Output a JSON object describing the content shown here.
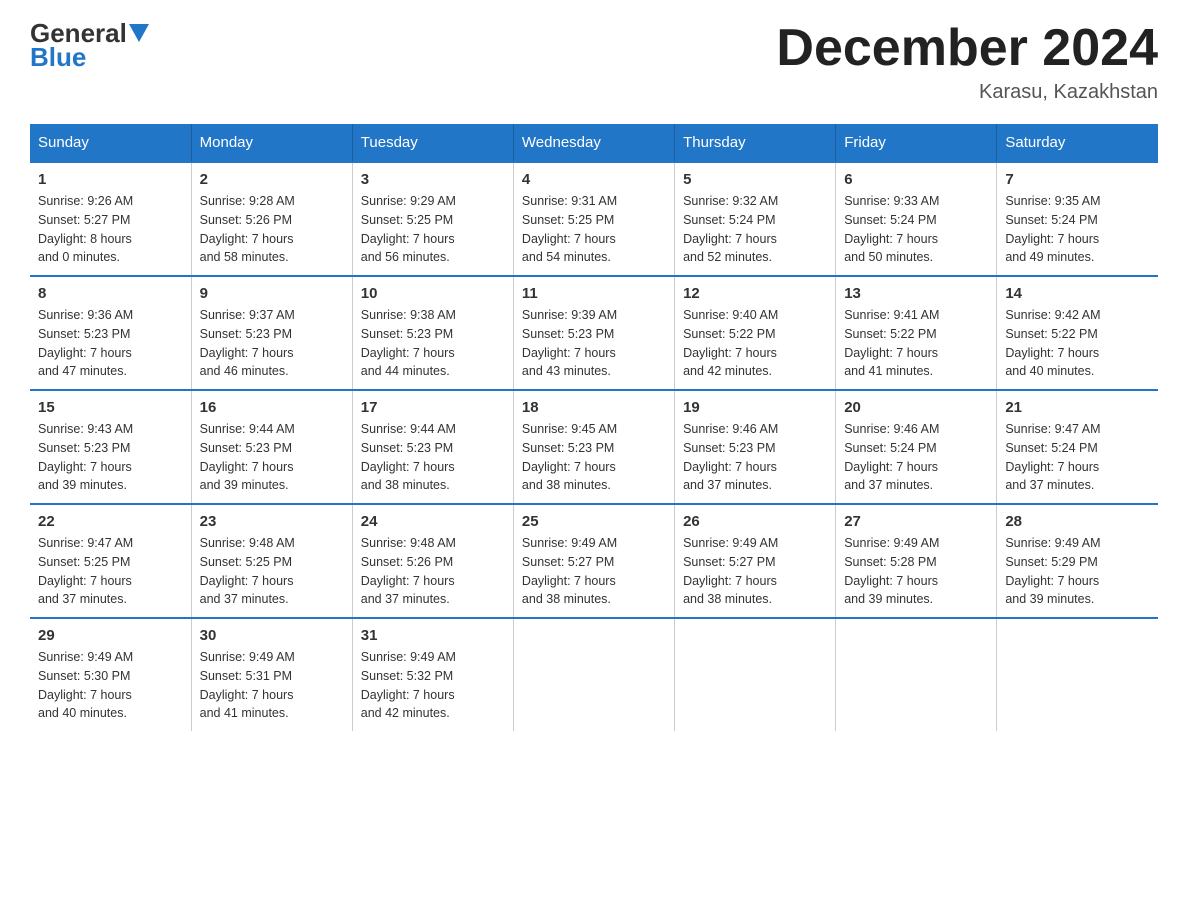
{
  "header": {
    "logo_general": "General",
    "logo_blue": "Blue",
    "month_title": "December 2024",
    "location": "Karasu, Kazakhstan"
  },
  "days_of_week": [
    "Sunday",
    "Monday",
    "Tuesday",
    "Wednesday",
    "Thursday",
    "Friday",
    "Saturday"
  ],
  "weeks": [
    [
      {
        "day": "1",
        "sunrise": "9:26 AM",
        "sunset": "5:27 PM",
        "daylight": "8 hours and 0 minutes."
      },
      {
        "day": "2",
        "sunrise": "9:28 AM",
        "sunset": "5:26 PM",
        "daylight": "7 hours and 58 minutes."
      },
      {
        "day": "3",
        "sunrise": "9:29 AM",
        "sunset": "5:25 PM",
        "daylight": "7 hours and 56 minutes."
      },
      {
        "day": "4",
        "sunrise": "9:31 AM",
        "sunset": "5:25 PM",
        "daylight": "7 hours and 54 minutes."
      },
      {
        "day": "5",
        "sunrise": "9:32 AM",
        "sunset": "5:24 PM",
        "daylight": "7 hours and 52 minutes."
      },
      {
        "day": "6",
        "sunrise": "9:33 AM",
        "sunset": "5:24 PM",
        "daylight": "7 hours and 50 minutes."
      },
      {
        "day": "7",
        "sunrise": "9:35 AM",
        "sunset": "5:24 PM",
        "daylight": "7 hours and 49 minutes."
      }
    ],
    [
      {
        "day": "8",
        "sunrise": "9:36 AM",
        "sunset": "5:23 PM",
        "daylight": "7 hours and 47 minutes."
      },
      {
        "day": "9",
        "sunrise": "9:37 AM",
        "sunset": "5:23 PM",
        "daylight": "7 hours and 46 minutes."
      },
      {
        "day": "10",
        "sunrise": "9:38 AM",
        "sunset": "5:23 PM",
        "daylight": "7 hours and 44 minutes."
      },
      {
        "day": "11",
        "sunrise": "9:39 AM",
        "sunset": "5:23 PM",
        "daylight": "7 hours and 43 minutes."
      },
      {
        "day": "12",
        "sunrise": "9:40 AM",
        "sunset": "5:22 PM",
        "daylight": "7 hours and 42 minutes."
      },
      {
        "day": "13",
        "sunrise": "9:41 AM",
        "sunset": "5:22 PM",
        "daylight": "7 hours and 41 minutes."
      },
      {
        "day": "14",
        "sunrise": "9:42 AM",
        "sunset": "5:22 PM",
        "daylight": "7 hours and 40 minutes."
      }
    ],
    [
      {
        "day": "15",
        "sunrise": "9:43 AM",
        "sunset": "5:23 PM",
        "daylight": "7 hours and 39 minutes."
      },
      {
        "day": "16",
        "sunrise": "9:44 AM",
        "sunset": "5:23 PM",
        "daylight": "7 hours and 39 minutes."
      },
      {
        "day": "17",
        "sunrise": "9:44 AM",
        "sunset": "5:23 PM",
        "daylight": "7 hours and 38 minutes."
      },
      {
        "day": "18",
        "sunrise": "9:45 AM",
        "sunset": "5:23 PM",
        "daylight": "7 hours and 38 minutes."
      },
      {
        "day": "19",
        "sunrise": "9:46 AM",
        "sunset": "5:23 PM",
        "daylight": "7 hours and 37 minutes."
      },
      {
        "day": "20",
        "sunrise": "9:46 AM",
        "sunset": "5:24 PM",
        "daylight": "7 hours and 37 minutes."
      },
      {
        "day": "21",
        "sunrise": "9:47 AM",
        "sunset": "5:24 PM",
        "daylight": "7 hours and 37 minutes."
      }
    ],
    [
      {
        "day": "22",
        "sunrise": "9:47 AM",
        "sunset": "5:25 PM",
        "daylight": "7 hours and 37 minutes."
      },
      {
        "day": "23",
        "sunrise": "9:48 AM",
        "sunset": "5:25 PM",
        "daylight": "7 hours and 37 minutes."
      },
      {
        "day": "24",
        "sunrise": "9:48 AM",
        "sunset": "5:26 PM",
        "daylight": "7 hours and 37 minutes."
      },
      {
        "day": "25",
        "sunrise": "9:49 AM",
        "sunset": "5:27 PM",
        "daylight": "7 hours and 38 minutes."
      },
      {
        "day": "26",
        "sunrise": "9:49 AM",
        "sunset": "5:27 PM",
        "daylight": "7 hours and 38 minutes."
      },
      {
        "day": "27",
        "sunrise": "9:49 AM",
        "sunset": "5:28 PM",
        "daylight": "7 hours and 39 minutes."
      },
      {
        "day": "28",
        "sunrise": "9:49 AM",
        "sunset": "5:29 PM",
        "daylight": "7 hours and 39 minutes."
      }
    ],
    [
      {
        "day": "29",
        "sunrise": "9:49 AM",
        "sunset": "5:30 PM",
        "daylight": "7 hours and 40 minutes."
      },
      {
        "day": "30",
        "sunrise": "9:49 AM",
        "sunset": "5:31 PM",
        "daylight": "7 hours and 41 minutes."
      },
      {
        "day": "31",
        "sunrise": "9:49 AM",
        "sunset": "5:32 PM",
        "daylight": "7 hours and 42 minutes."
      },
      null,
      null,
      null,
      null
    ]
  ]
}
